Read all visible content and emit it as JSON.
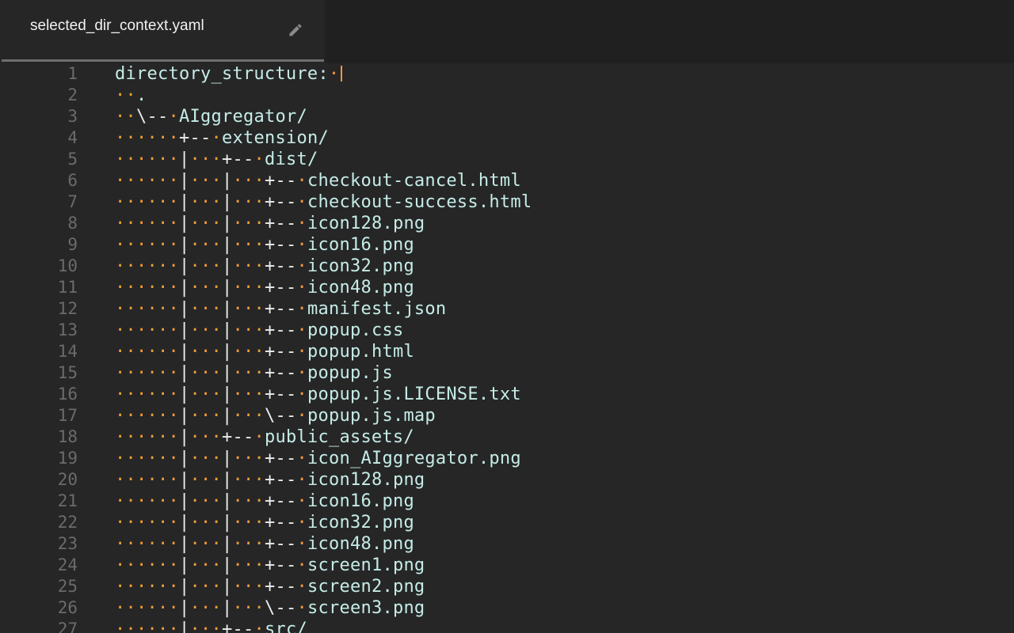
{
  "tab": {
    "title": "selected_dir_context.yaml",
    "edit_icon": "pencil-icon"
  },
  "colors": {
    "background": "#262626",
    "tabbar": "#202020",
    "whitespace_marker": "#f29a3a",
    "text": "#c5ece7"
  },
  "editor": {
    "lines": [
      {
        "number": "1",
        "text": "directory_structure: "
      },
      {
        "number": "2",
        "text": "  ."
      },
      {
        "number": "3",
        "text": "  \\-- AIggregator/"
      },
      {
        "number": "4",
        "text": "      +-- extension/"
      },
      {
        "number": "5",
        "text": "      |   +-- dist/"
      },
      {
        "number": "6",
        "text": "      |   |   +-- checkout-cancel.html"
      },
      {
        "number": "7",
        "text": "      |   |   +-- checkout-success.html"
      },
      {
        "number": "8",
        "text": "      |   |   +-- icon128.png"
      },
      {
        "number": "9",
        "text": "      |   |   +-- icon16.png"
      },
      {
        "number": "10",
        "text": "      |   |   +-- icon32.png"
      },
      {
        "number": "11",
        "text": "      |   |   +-- icon48.png"
      },
      {
        "number": "12",
        "text": "      |   |   +-- manifest.json"
      },
      {
        "number": "13",
        "text": "      |   |   +-- popup.css"
      },
      {
        "number": "14",
        "text": "      |   |   +-- popup.html"
      },
      {
        "number": "15",
        "text": "      |   |   +-- popup.js"
      },
      {
        "number": "16",
        "text": "      |   |   +-- popup.js.LICENSE.txt"
      },
      {
        "number": "17",
        "text": "      |   |   \\-- popup.js.map"
      },
      {
        "number": "18",
        "text": "      |   +-- public_assets/"
      },
      {
        "number": "19",
        "text": "      |   |   +-- icon_AIggregator.png"
      },
      {
        "number": "20",
        "text": "      |   |   +-- icon128.png"
      },
      {
        "number": "21",
        "text": "      |   |   +-- icon16.png"
      },
      {
        "number": "22",
        "text": "      |   |   +-- icon32.png"
      },
      {
        "number": "23",
        "text": "      |   |   +-- icon48.png"
      },
      {
        "number": "24",
        "text": "      |   |   +-- screen1.png"
      },
      {
        "number": "25",
        "text": "      |   |   +-- screen2.png"
      },
      {
        "number": "26",
        "text": "      |   |   \\-- screen3.png"
      },
      {
        "number": "27",
        "text": "      |   +-- src/"
      }
    ]
  }
}
